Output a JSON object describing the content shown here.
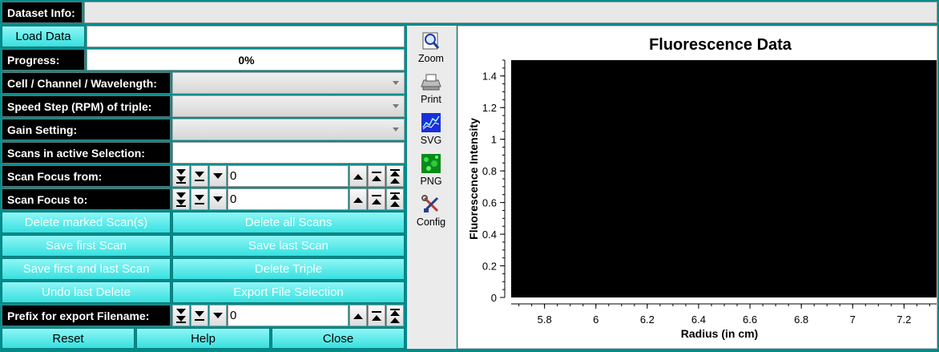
{
  "header": {
    "dataset_info_label": "Dataset Info:",
    "dataset_info_value": ""
  },
  "controls": {
    "load_data_label": "Load Data",
    "load_data_value": "",
    "progress_label": "Progress:",
    "progress_value": "0%",
    "cell_label": "Cell / Channel / Wavelength:",
    "speed_label": "Speed Step (RPM) of triple:",
    "gain_label": "Gain Setting:",
    "scans_active_label": "Scans in active Selection:",
    "scans_active_value": "",
    "focus_from_label": "Scan Focus from:",
    "focus_from_value": "0",
    "focus_to_label": "Scan Focus to:",
    "focus_to_value": "0",
    "prefix_label": "Prefix for export Filename:",
    "prefix_value": "0"
  },
  "buttons": {
    "delete_marked": "Delete marked Scan(s)",
    "delete_all": "Delete all Scans",
    "save_first": "Save first Scan",
    "save_last": "Save last Scan",
    "save_first_last": "Save first and last Scan",
    "delete_triple": "Delete Triple",
    "undo_delete": "Undo last Delete",
    "export_selection": "Export File Selection",
    "reset": "Reset",
    "help": "Help",
    "close": "Close"
  },
  "toolbar": {
    "zoom": "Zoom",
    "print": "Print",
    "svg": "SVG",
    "png": "PNG",
    "config": "Config"
  },
  "colors": {
    "background": "#008b8b",
    "button": "#4ae8e8",
    "plot_canvas": "#000000"
  },
  "chart_data": {
    "type": "line",
    "title": "Fluorescence Data",
    "xlabel": "Radius (in cm)",
    "ylabel": "Fluorescence Intensity",
    "xlim": [
      5.67,
      7.33
    ],
    "ylim": [
      0,
      1.5
    ],
    "x_ticks": [
      "5.8",
      "6",
      "6.2",
      "6.4",
      "6.6",
      "6.8",
      "7",
      "7.2"
    ],
    "y_ticks": [
      "0",
      "0.2",
      "0.4",
      "0.6",
      "0.8",
      "1",
      "1.2",
      "1.4"
    ],
    "series": [],
    "grid": false
  }
}
